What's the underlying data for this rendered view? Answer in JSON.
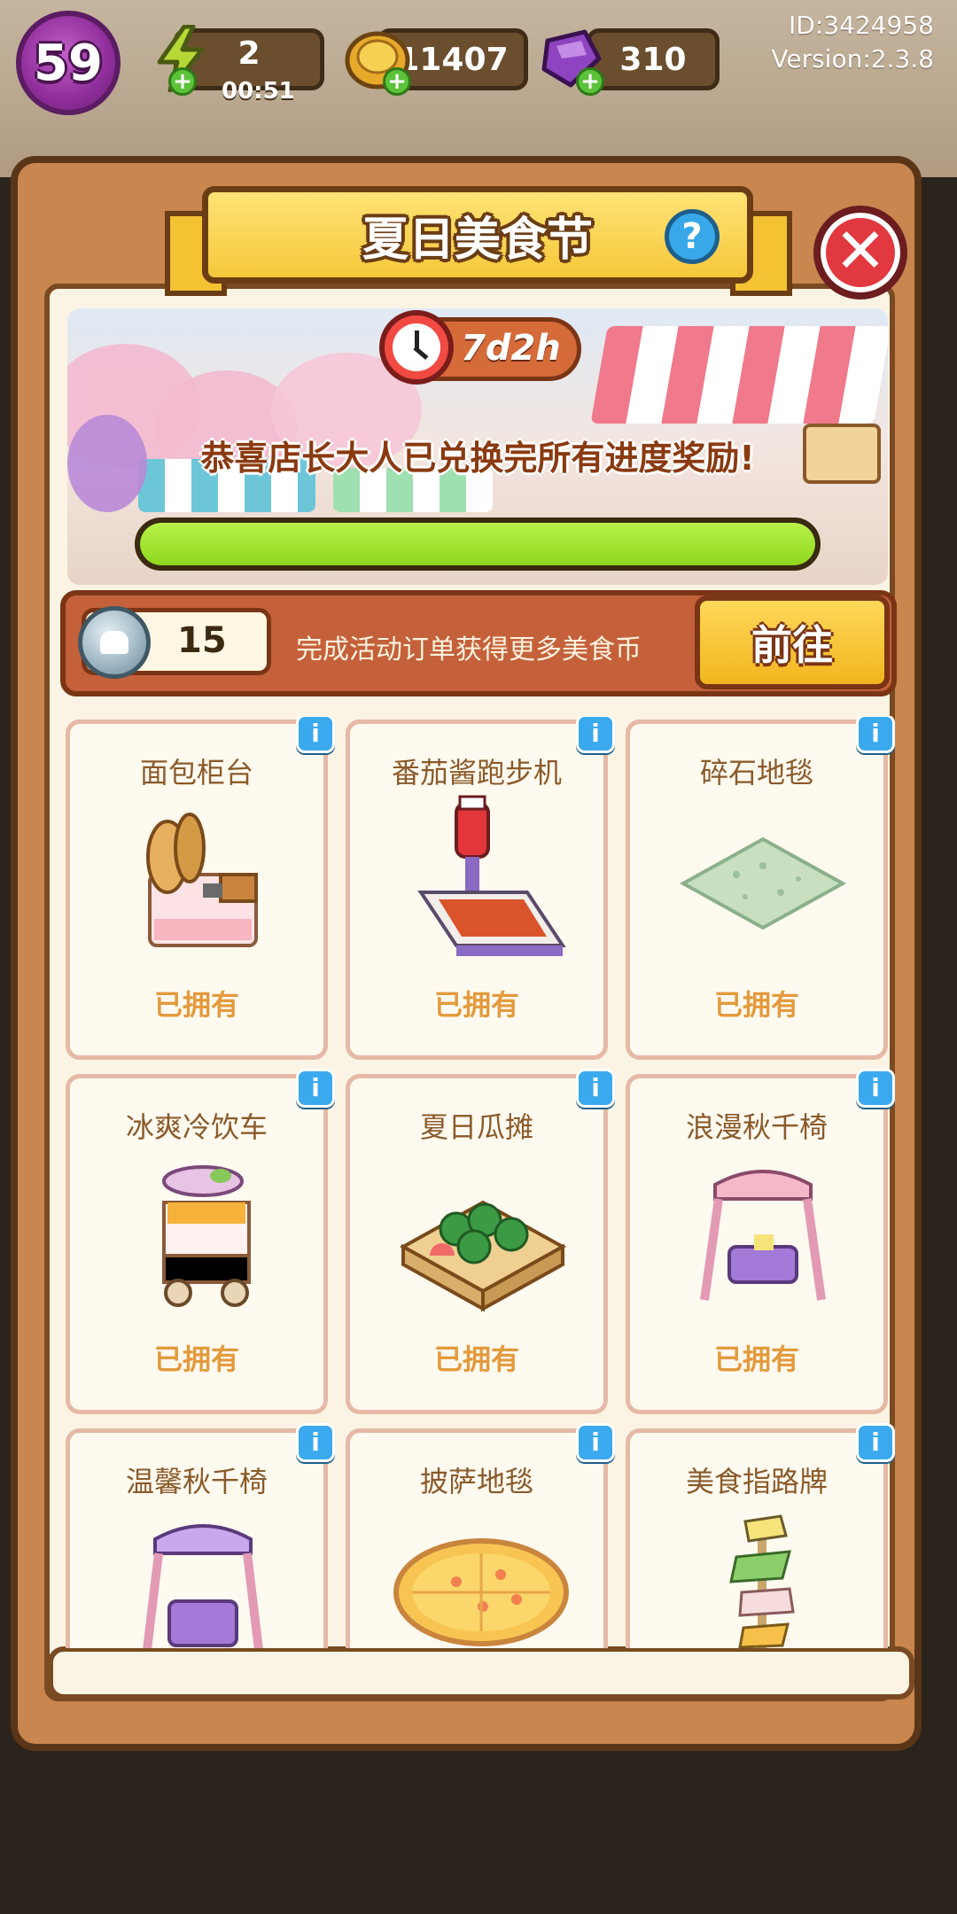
{
  "hud": {
    "level": "59",
    "energy": {
      "value": "2",
      "timer": "00:51"
    },
    "coins": {
      "value": "11407"
    },
    "gems": {
      "value": "310"
    },
    "id_text": "ID:3424958",
    "version_text": "Version:2.3.8"
  },
  "panel": {
    "title": "夏日美食节",
    "help_label": "?",
    "close_label": "✕"
  },
  "event": {
    "timer": "7d2h",
    "congrats_text": "恭喜店长大人已兑换完所有进度奖励!",
    "progress": 1.0
  },
  "currency": {
    "count": "15",
    "description": "完成活动订单获得更多美食币",
    "goto_label": "前往"
  },
  "items": [
    {
      "title": "面包柜台",
      "status": "已拥有",
      "icon": "bread-counter-icon"
    },
    {
      "title": "番茄酱跑步机",
      "status": "已拥有",
      "icon": "ketchup-treadmill-icon"
    },
    {
      "title": "碎石地毯",
      "status": "已拥有",
      "icon": "gravel-rug-icon"
    },
    {
      "title": "冰爽冷饮车",
      "status": "已拥有",
      "icon": "drink-cart-icon"
    },
    {
      "title": "夏日瓜摊",
      "status": "已拥有",
      "icon": "melon-stand-icon"
    },
    {
      "title": "浪漫秋千椅",
      "status": "已拥有",
      "icon": "pink-swing-icon"
    },
    {
      "title": "温馨秋千椅",
      "status": "",
      "icon": "purple-swing-icon"
    },
    {
      "title": "披萨地毯",
      "status": "",
      "icon": "pizza-rug-icon"
    },
    {
      "title": "美食指路牌",
      "status": "",
      "icon": "food-signpost-icon"
    }
  ],
  "info_label": "i",
  "colors": {
    "panel_wood": "#c9864e",
    "banner_yellow": "#f5c83a",
    "progress_green": "#9be12e",
    "owned_text": "#e39a3c"
  }
}
